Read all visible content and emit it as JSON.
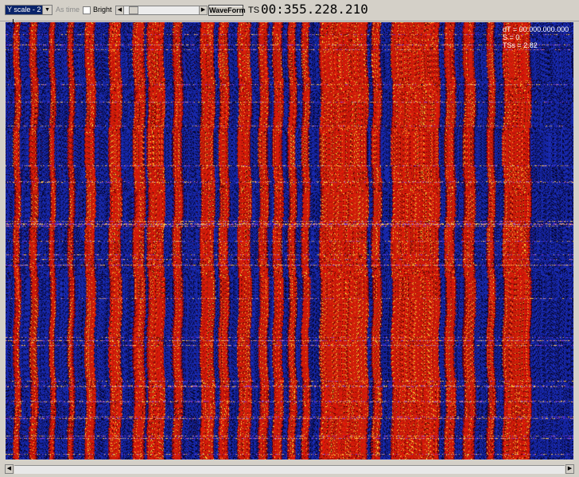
{
  "toolbar": {
    "scale_value": "Y scale - 2",
    "as_time_label": "As time",
    "bright_label": "Bright",
    "waveform_button": "WaveForm",
    "ts_label": "TS",
    "ts_value": "00:355.228.210"
  },
  "readout": {
    "dt": "dT = 00.000.000.000",
    "s": "S = 0",
    "tss": "TSs = 2.82"
  },
  "icons": {
    "dropdown": "chevron-down-icon",
    "scroll_left": "arrow-left-icon",
    "scroll_right": "arrow-right-icon"
  },
  "colors": {
    "background_blue": "#1a2a9a",
    "signal_red": "#c01808",
    "signal_dark": "#180000",
    "peak_yellow": "#ffd040",
    "window_gray": "#d4d0c8"
  }
}
